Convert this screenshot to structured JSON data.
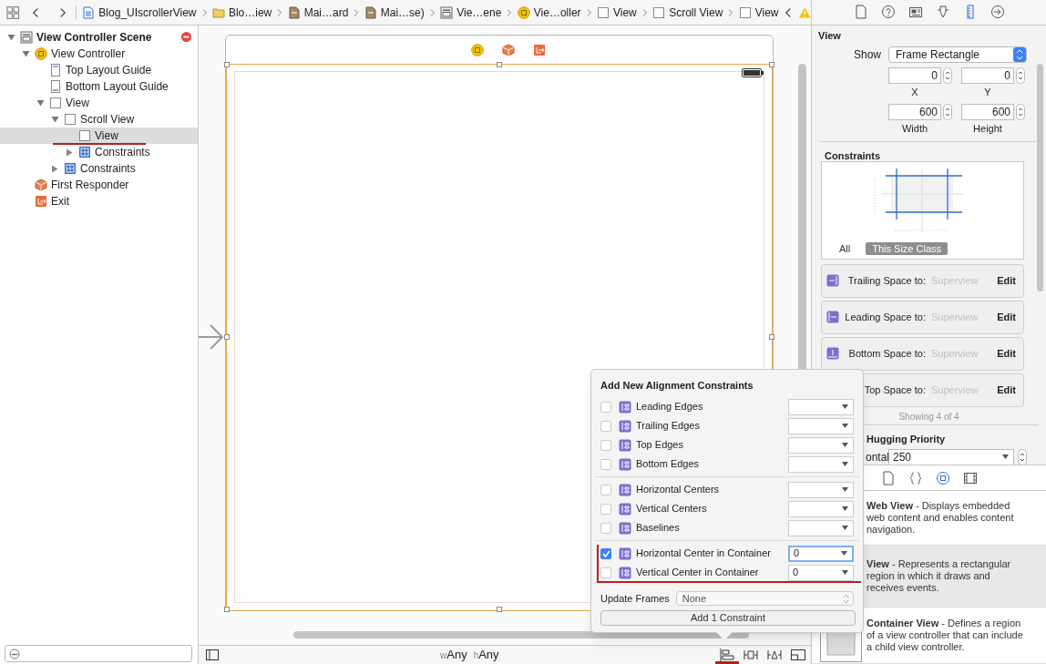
{
  "jump_bar": {
    "crumbs": [
      {
        "label": "Blog_UIscrollerView",
        "kind": "file"
      },
      {
        "label": "Blo…iew",
        "kind": "folder"
      },
      {
        "label": "Mai…ard",
        "kind": "storyboard"
      },
      {
        "label": "Mai…se)",
        "kind": "storyboard"
      },
      {
        "label": "Vie…ene",
        "kind": "scene"
      },
      {
        "label": "Vie…oller",
        "kind": "controller"
      },
      {
        "label": "View",
        "kind": "view"
      },
      {
        "label": "Scroll View",
        "kind": "view"
      },
      {
        "label": "View",
        "kind": "view"
      }
    ],
    "has_warning": true
  },
  "outline": [
    {
      "label": "View Controller Scene",
      "kind": "scene",
      "heading": true,
      "has_issue": true,
      "expanded": true,
      "selected": false,
      "children": [
        {
          "label": "View Controller",
          "kind": "controller",
          "expanded": true,
          "selected": false,
          "children": [
            {
              "label": "Top Layout Guide",
              "kind": "guide-top",
              "selected": false
            },
            {
              "label": "Bottom Layout Guide",
              "kind": "guide-bottom",
              "selected": false
            },
            {
              "label": "View",
              "kind": "view",
              "expanded": true,
              "selected": false,
              "children": [
                {
                  "label": "Scroll View",
                  "kind": "view",
                  "expanded": true,
                  "selected": false,
                  "children": [
                    {
                      "label": "View",
                      "kind": "view",
                      "selected": true
                    },
                    {
                      "label": "Constraints",
                      "kind": "constraints",
                      "expanded": false,
                      "selected": false
                    }
                  ]
                },
                {
                  "label": "Constraints",
                  "kind": "constraints",
                  "expanded": false,
                  "selected": false
                }
              ]
            }
          ]
        },
        {
          "label": "First Responder",
          "kind": "responder",
          "selected": false
        },
        {
          "label": "Exit",
          "kind": "exit",
          "selected": false
        }
      ]
    }
  ],
  "size_class": {
    "w_prefix": "w",
    "w": "Any",
    "h_prefix": "h",
    "h": "Any"
  },
  "inspector": {
    "tabs": [
      {
        "kind": "file",
        "selected": false
      },
      {
        "kind": "help",
        "selected": false
      },
      {
        "kind": "identity",
        "selected": false
      },
      {
        "kind": "attributes",
        "selected": false
      },
      {
        "kind": "size",
        "selected": true
      },
      {
        "kind": "connections",
        "selected": false
      }
    ],
    "section": "View",
    "show_label": "Show",
    "show_value": "Frame Rectangle",
    "fields": [
      {
        "label": "X",
        "value": "0"
      },
      {
        "label": "Y",
        "value": "0"
      },
      {
        "label": "Width",
        "value": "600"
      },
      {
        "label": "Height",
        "value": "600"
      }
    ],
    "constraints_heading": "Constraints",
    "scopes": [
      {
        "label": "All",
        "selected": false
      },
      {
        "label": "This Size Class",
        "selected": true
      }
    ],
    "constraints": [
      {
        "label": "Trailing Space to:",
        "target": "Superview",
        "action": "Edit",
        "kind": "trailing"
      },
      {
        "label": "Leading Space to:",
        "target": "Superview",
        "action": "Edit",
        "kind": "leading"
      },
      {
        "label": "Bottom Space to:",
        "target": "Superview",
        "action": "Edit",
        "kind": "bottom"
      },
      {
        "label": "Top Space to:",
        "target": "Superview",
        "action": "Edit"
      }
    ],
    "count": "Showing 4 of 4",
    "hugging_heading": "Hugging Priority",
    "hugging_rows": [
      {
        "label": "ontal",
        "value": "250"
      }
    ]
  },
  "library": {
    "tabs": [
      {
        "kind": "file",
        "selected": false
      },
      {
        "kind": "code",
        "selected": false
      },
      {
        "kind": "object",
        "selected": true
      },
      {
        "kind": "media",
        "selected": false
      }
    ],
    "items": [
      {
        "text": "**Web View** - Displays embedded web content and enables content navigation.",
        "selected": false
      },
      {
        "text": "**View** - Represents a rectangular region in which it draws and receives events.",
        "selected": true
      },
      {
        "text": "**Container View** - Defines a region of a view controller that can include a child view controller.",
        "selected": false,
        "kind": "container"
      }
    ]
  },
  "popup": {
    "title": "Add New Alignment Constraints",
    "groups": [
      [
        {
          "label": "Leading Edges",
          "checked": false
        },
        {
          "label": "Trailing Edges",
          "checked": false
        },
        {
          "label": "Top Edges",
          "checked": false
        },
        {
          "label": "Bottom Edges",
          "checked": false
        }
      ],
      [
        {
          "label": "Horizontal Centers",
          "checked": false
        },
        {
          "label": "Vertical Centers",
          "checked": false
        },
        {
          "label": "Baselines",
          "checked": false
        }
      ],
      [
        {
          "label": "Horizontal Center in Container",
          "checked": true,
          "value": "0",
          "focused": true
        },
        {
          "label": "Vertical Center in Container",
          "checked": false,
          "value": "0",
          "focused": false
        }
      ]
    ],
    "update_label": "Update Frames",
    "update_value": "None",
    "button": "Add 1 Constraint"
  }
}
